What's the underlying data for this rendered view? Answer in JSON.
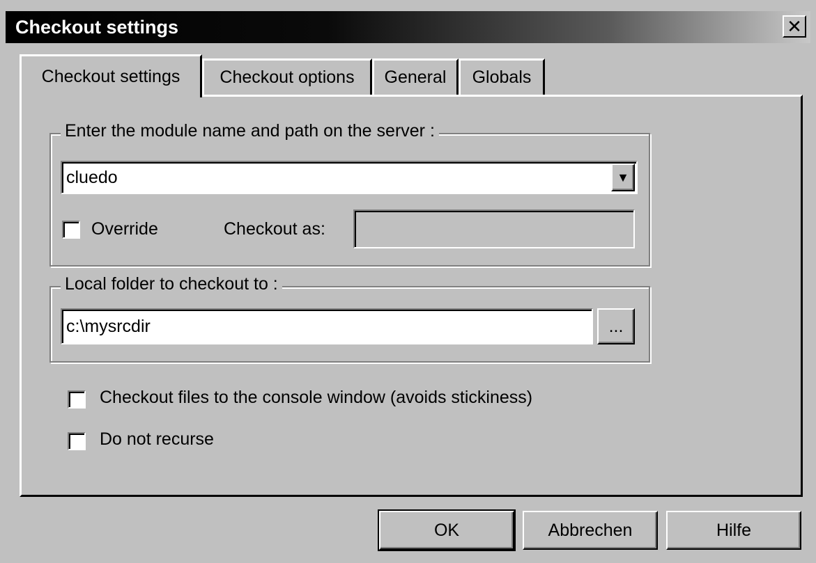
{
  "window": {
    "title": "Checkout settings",
    "close_glyph": "✕"
  },
  "tabs": [
    {
      "label": "Checkout settings"
    },
    {
      "label": "Checkout options"
    },
    {
      "label": "General"
    },
    {
      "label": "Globals"
    }
  ],
  "module_group": {
    "legend": "Enter the module name and path on the server :",
    "module_value": "cluedo",
    "dropdown_glyph": "▼",
    "override_label": "Override",
    "override_checked": false,
    "checkout_as_label": "Checkout as:",
    "checkout_as_value": ""
  },
  "folder_group": {
    "legend": "Local folder to checkout to :",
    "folder_value": "c:\\mysrcdir",
    "browse_label": "..."
  },
  "options": {
    "console_label": "Checkout files to the console window (avoids stickiness)",
    "console_checked": false,
    "norecurse_label": "Do not recurse",
    "norecurse_checked": false
  },
  "buttons": {
    "ok": "OK",
    "cancel": "Abbrechen",
    "help": "Hilfe"
  }
}
